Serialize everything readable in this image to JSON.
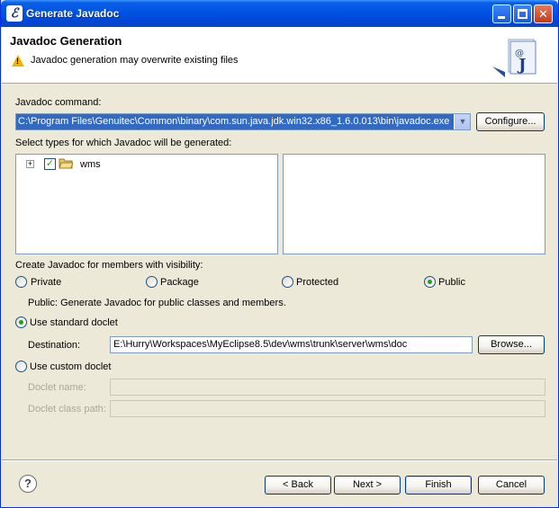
{
  "window": {
    "title": "Generate Javadoc",
    "app_icon": "eclipse-icon"
  },
  "banner": {
    "title": "Javadoc Generation",
    "message": "Javadoc generation may overwrite existing files",
    "message_icon": "warning-icon",
    "logo_icon": "javadoc-logo-icon"
  },
  "javadoc_command": {
    "label": "Javadoc command:",
    "value": "C:\\Program Files\\Genuitec\\Common\\binary\\com.sun.java.jdk.win32.x86_1.6.0.013\\bin\\javadoc.exe",
    "configure_label": "Configure..."
  },
  "types": {
    "label": "Select types for which Javadoc will be generated:",
    "tree": [
      {
        "label": "wms",
        "checked": true,
        "expand_symbol": "+"
      }
    ]
  },
  "visibility": {
    "label": "Create Javadoc for members with visibility:",
    "options": [
      "Private",
      "Package",
      "Protected",
      "Public"
    ],
    "selected": "Public",
    "description": "Public: Generate Javadoc for public classes and members."
  },
  "doclet": {
    "standard_label": "Use standard doclet",
    "standard_selected": true,
    "destination_label": "Destination:",
    "destination_value": "E:\\Hurry\\Workspaces\\MyEclipse8.5\\dev\\wms\\trunk\\server\\wms\\doc",
    "browse_label": "Browse...",
    "custom_label": "Use custom doclet",
    "doclet_name_label": "Doclet name:",
    "doclet_name_value": "",
    "doclet_classpath_label": "Doclet class path:",
    "doclet_classpath_value": ""
  },
  "footer": {
    "help_symbol": "?",
    "back_label": "< Back",
    "next_label": "Next >",
    "finish_label": "Finish",
    "cancel_label": "Cancel"
  },
  "colors": {
    "titlebar": "#0054e3",
    "selection": "#316ac5",
    "check_green": "#21a121",
    "warning": "#f0b400"
  }
}
